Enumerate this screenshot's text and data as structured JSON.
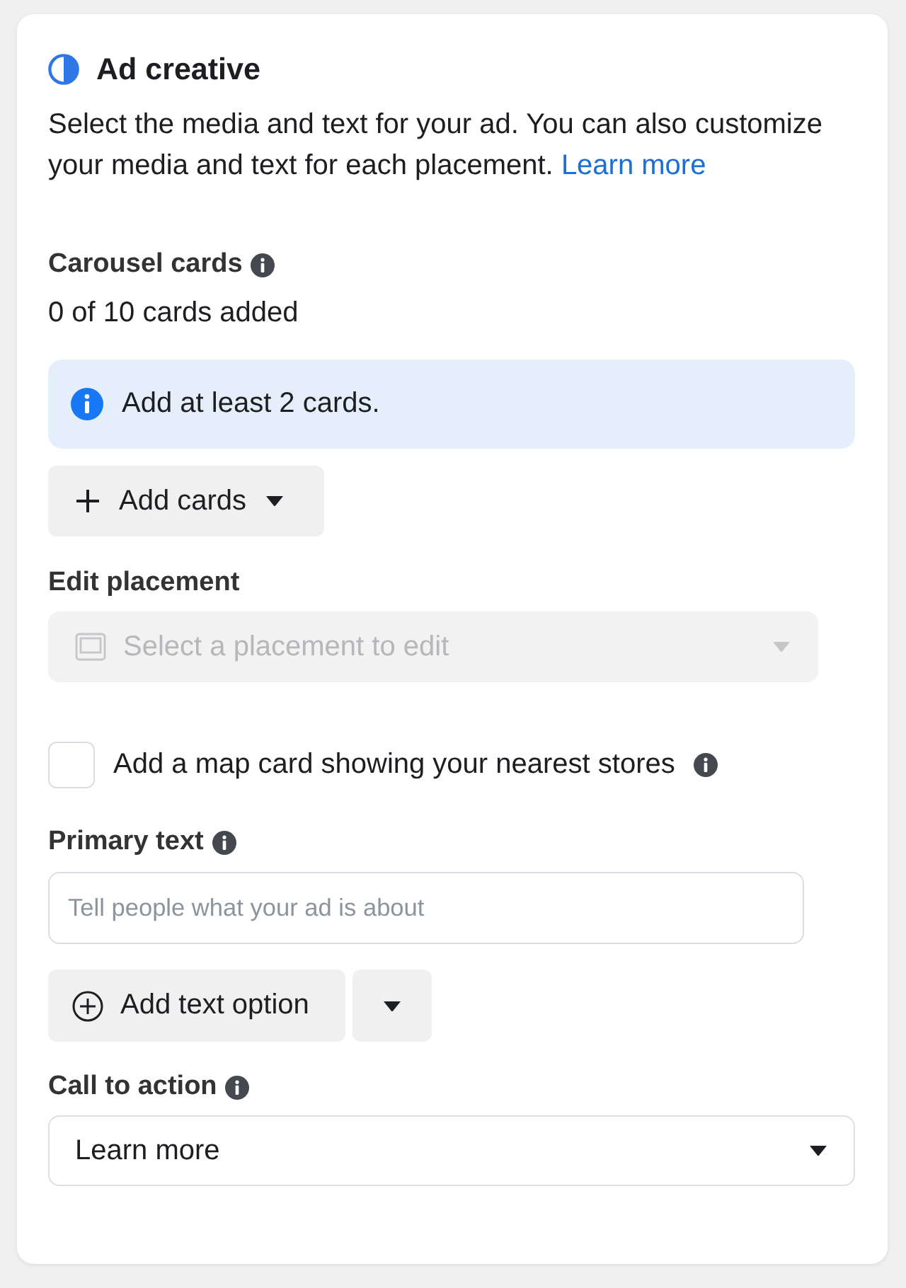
{
  "panel": {
    "title": "Ad creative",
    "description": "Select the media and text for your ad. You can also customize your media and text for each placement.",
    "link": "Learn more"
  },
  "carousel_cards": {
    "label": "Carousel cards",
    "count": "0 of 10 cards added",
    "notice": "Add at least 2 cards.",
    "add_button": "Add cards"
  },
  "edit_placement": {
    "label": "Edit placement",
    "placeholder": "Select a placement to edit",
    "disabled": true
  },
  "map_card": {
    "label": "Add a map card showing your nearest stores",
    "checked": false
  },
  "primary_text": {
    "label": "Primary text",
    "placeholder": "Tell people what your ad is about",
    "add_option_button": "Add text option"
  },
  "call_to_action": {
    "label": "Call to action",
    "value": "Learn more"
  }
}
